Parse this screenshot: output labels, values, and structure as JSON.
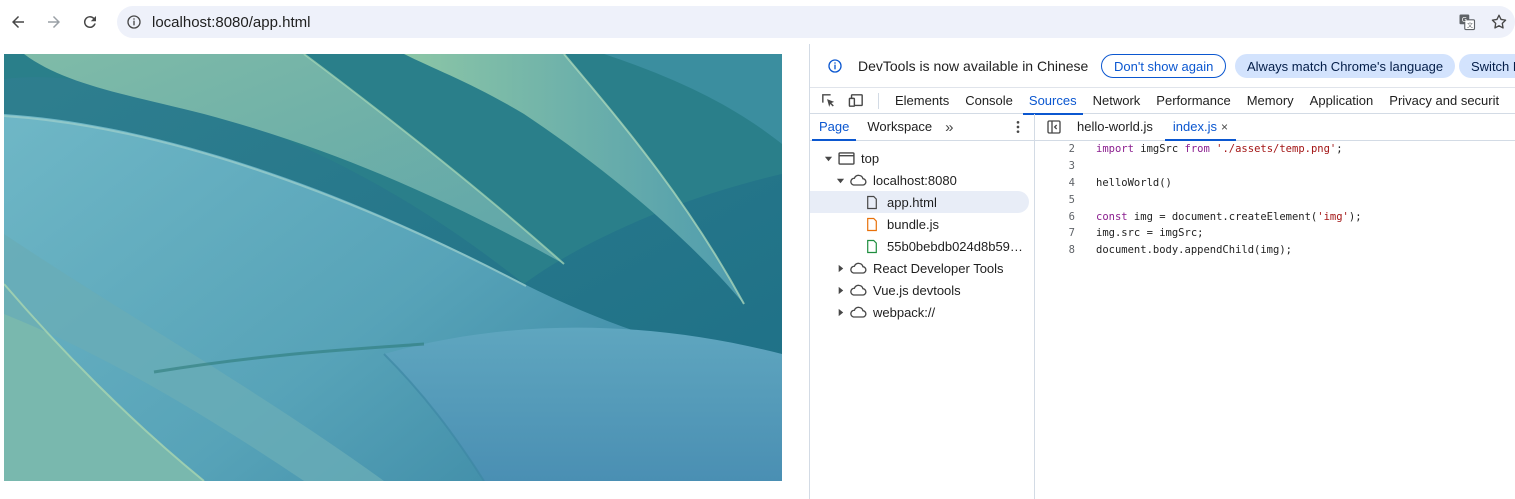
{
  "browser": {
    "url": "localhost:8080/app.html",
    "icons": [
      "back-arrow-icon",
      "forward-arrow-icon",
      "reload-icon",
      "site-info-icon",
      "translate-icon",
      "bookmark-star-icon"
    ]
  },
  "page": {
    "image_desc_icon": "agave-leaves-image"
  },
  "devtools": {
    "infobar": {
      "message": "DevTools is now available in Chinese",
      "dont_show": "Don't show again",
      "always_match": "Always match Chrome's language",
      "switch": "Switch D"
    },
    "main_tabs": [
      "Elements",
      "Console",
      "Sources",
      "Network",
      "Performance",
      "Memory",
      "Application",
      "Privacy and securit"
    ],
    "active_main_tab": "Sources",
    "navigator": {
      "tabs": [
        "Page",
        "Workspace"
      ],
      "more": "»",
      "tree": {
        "top": "top",
        "host": "localhost:8080",
        "files": [
          "app.html",
          "bundle.js",
          "55b0bebdb024d8b59…"
        ],
        "extensions": [
          "React Developer Tools",
          "Vue.js devtools",
          "webpack://"
        ]
      }
    },
    "editor": {
      "tabs": [
        "hello-world.js",
        "index.js"
      ],
      "active_tab": "index.js",
      "close_glyph": "×",
      "line_numbers": [
        "2",
        "3",
        "4",
        "5",
        "6",
        "7",
        "8"
      ]
    }
  },
  "colors": {
    "accent": "#0b57d0",
    "omnibox_bg": "#eef1fa",
    "selected_row": "#e8edf7",
    "pill_filled": "#d3e3fd"
  }
}
